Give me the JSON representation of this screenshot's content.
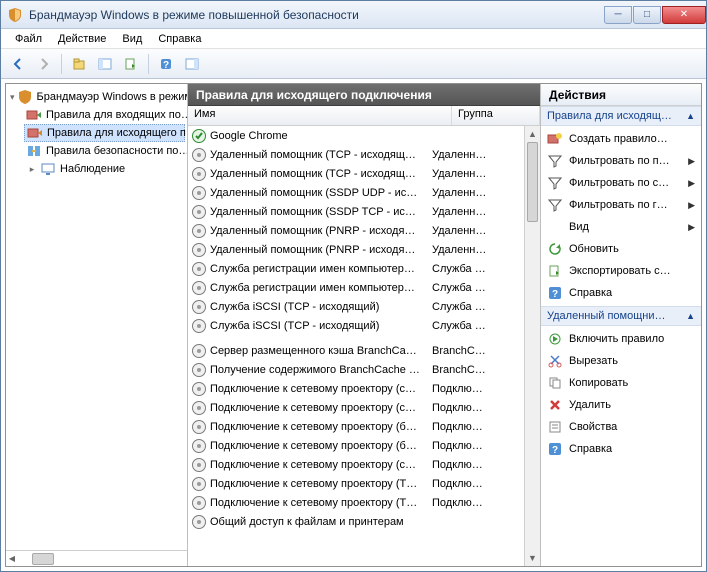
{
  "window": {
    "title": "Брандмауэр Windows в режиме повышенной безопасности"
  },
  "menu": {
    "file": "Файл",
    "action": "Действие",
    "view": "Вид",
    "help": "Справка"
  },
  "tree": {
    "root": "Брандмауэр Windows в режим",
    "items": [
      "Правила для входящих по…",
      "Правила для исходящего п",
      "Правила безопасности по…",
      "Наблюдение"
    ]
  },
  "center": {
    "title": "Правила для исходящего подключения",
    "col_name": "Имя",
    "col_group": "Группа",
    "rows": [
      {
        "name": "Google Chrome",
        "group": "",
        "enabled": true
      },
      {
        "name": "Удаленный помощник (TCP - исходящ…",
        "group": "Удаленн…",
        "enabled": false
      },
      {
        "name": "Удаленный помощник (TCP - исходящ…",
        "group": "Удаленн…",
        "enabled": false
      },
      {
        "name": "Удаленный помощник (SSDP UDP - ис…",
        "group": "Удаленн…",
        "enabled": false
      },
      {
        "name": "Удаленный помощник (SSDP TCP - ис…",
        "group": "Удаленн…",
        "enabled": false
      },
      {
        "name": "Удаленный помощник (PNRP - исходя…",
        "group": "Удаленн…",
        "enabled": false
      },
      {
        "name": "Удаленный помощник (PNRP - исходя…",
        "group": "Удаленн…",
        "enabled": false
      },
      {
        "name": "Служба регистрации имен компьютер…",
        "group": "Служба …",
        "enabled": false
      },
      {
        "name": "Служба регистрации имен компьютер…",
        "group": "Служба …",
        "enabled": false
      },
      {
        "name": "Служба iSCSI (TCP - исходящий)",
        "group": "Служба …",
        "enabled": false
      },
      {
        "name": "Служба iSCSI (TCP - исходящий)",
        "group": "Служба …",
        "enabled": false
      },
      {
        "name": "Сервер размещенного кэша BranchCa…",
        "group": "BranchC…",
        "enabled": false,
        "spacer_before": true
      },
      {
        "name": "Получение содержимого BranchCache …",
        "group": "BranchC…",
        "enabled": false
      },
      {
        "name": "Подключение к сетевому проектору (с…",
        "group": "Подклю…",
        "enabled": false
      },
      {
        "name": "Подключение к сетевому проектору (с…",
        "group": "Подклю…",
        "enabled": false
      },
      {
        "name": "Подключение к сетевому проектору (б…",
        "group": "Подклю…",
        "enabled": false
      },
      {
        "name": "Подключение к сетевому проектору (б…",
        "group": "Подклю…",
        "enabled": false
      },
      {
        "name": "Подключение к сетевому проектору (с…",
        "group": "Подклю…",
        "enabled": false
      },
      {
        "name": "Подключение к сетевому проектору (T…",
        "group": "Подклю…",
        "enabled": false
      },
      {
        "name": "Подключение к сетевому проектору (T…",
        "group": "Подклю…",
        "enabled": false
      },
      {
        "name": "Общий доступ к файлам и принтерам",
        "group": "",
        "enabled": false
      }
    ]
  },
  "actions": {
    "header": "Действия",
    "section1": "Правила для исходящ…",
    "section2": "Удаленный помощни…",
    "s1": {
      "new_rule": "Создать правило…",
      "filter_profile": "Фильтровать по п…",
      "filter_state": "Фильтровать по с…",
      "filter_group": "Фильтровать по г…",
      "view": "Вид",
      "refresh": "Обновить",
      "export": "Экспортировать с…",
      "help": "Справка"
    },
    "s2": {
      "enable": "Включить правило",
      "cut": "Вырезать",
      "copy": "Копировать",
      "delete": "Удалить",
      "props": "Свойства",
      "help": "Справка"
    }
  }
}
